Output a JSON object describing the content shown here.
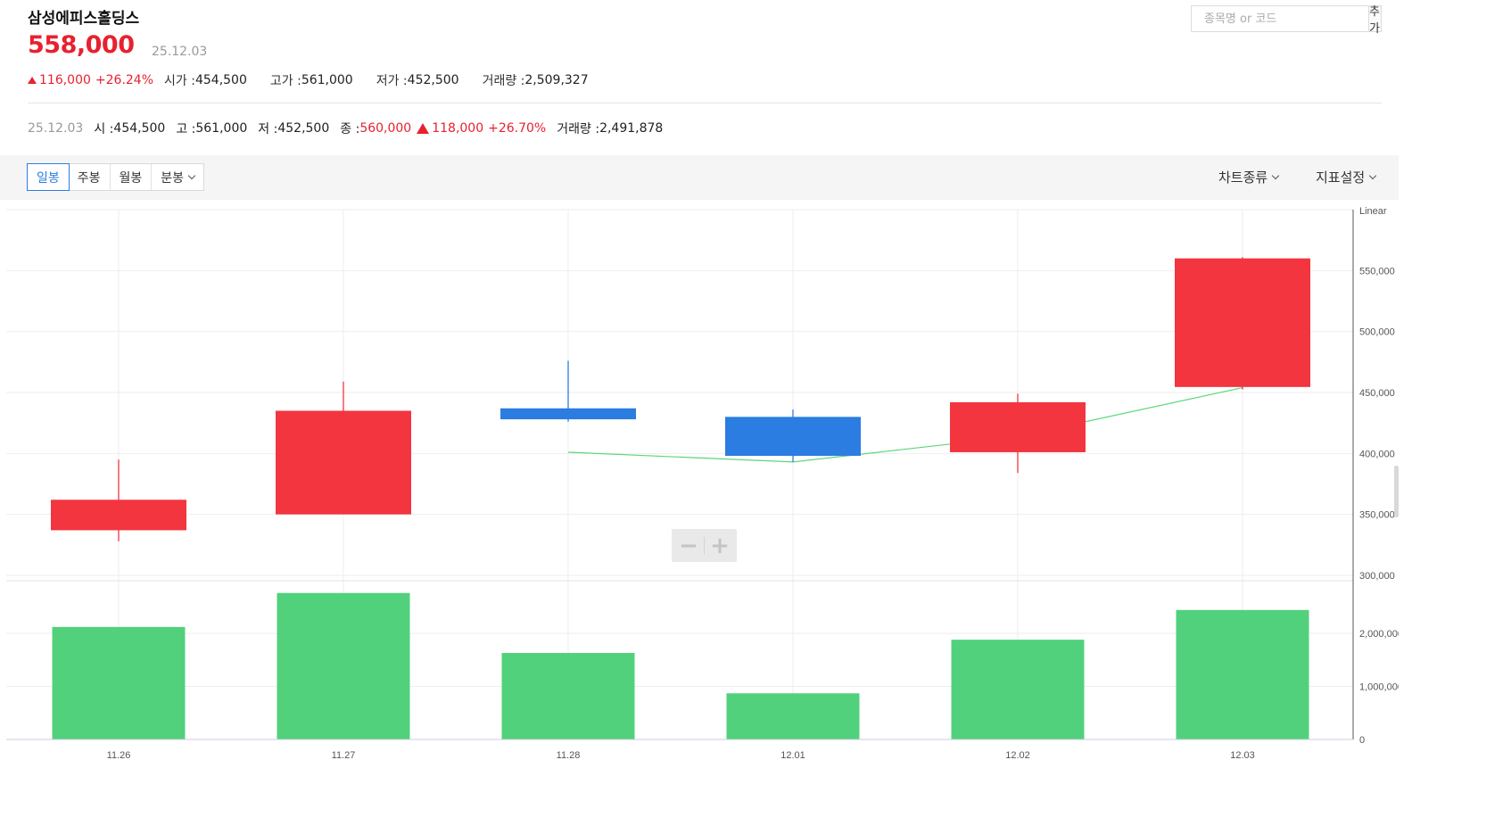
{
  "stock": {
    "name": "삼성에피스홀딩스",
    "price": "558,000",
    "date": "25.12.03",
    "change": "116,000",
    "change_pct": "+26.24%",
    "open_label": "시가 : ",
    "open": "454,500",
    "high_label": "고가 : ",
    "high": "561,000",
    "low_label": "저가 : ",
    "low": "452,500",
    "volume_label": "거래량 : ",
    "volume": "2,509,327"
  },
  "daily": {
    "date": "25.12.03",
    "open_label": "시 : ",
    "open": "454,500",
    "high_label": "고 : ",
    "high": "561,000",
    "low_label": "저 : ",
    "low": "452,500",
    "close_label": "종 : ",
    "close": "560,000",
    "change": "118,000",
    "change_pct": "+26.70%",
    "volume_label": "거래량 : ",
    "volume": "2,491,878"
  },
  "search": {
    "placeholder": "종목명 or 코드",
    "value": "",
    "add_label": "추가"
  },
  "toolbar": {
    "tabs": [
      {
        "label": "일봉",
        "active": true
      },
      {
        "label": "주봉",
        "active": false
      },
      {
        "label": "월봉",
        "active": false
      },
      {
        "label": "분봉",
        "active": false
      }
    ],
    "chart_type_label": "차트종류",
    "indicator_label": "지표설정"
  },
  "zoom": {
    "minus": "−",
    "plus": "+"
  },
  "colors": {
    "up": "#f2353f",
    "down": "#2b7de1",
    "ma": "#5cd67a",
    "volume": "#52d17d",
    "price_text_up": "#e8212f",
    "grid": "#eeeeee"
  },
  "chart_data": {
    "type": "candlestick",
    "scale_label": "Linear",
    "x": [
      "11.26",
      "11.27",
      "11.28",
      "12.01",
      "12.02",
      "12.03"
    ],
    "candles": [
      {
        "date": "11.26",
        "open": 337000,
        "high": 395000,
        "low": 328000,
        "close": 362000
      },
      {
        "date": "11.27",
        "open": 350000,
        "high": 459000,
        "low": 350000,
        "close": 435000
      },
      {
        "date": "11.28",
        "open": 437000,
        "high": 476000,
        "low": 426000,
        "close": 428000
      },
      {
        "date": "12.01",
        "open": 430000,
        "high": 436000,
        "low": 393000,
        "close": 398000
      },
      {
        "date": "12.02",
        "open": 401000,
        "high": 449000,
        "low": 384000,
        "close": 442000
      },
      {
        "date": "12.03",
        "open": 454500,
        "high": 561000,
        "low": 452500,
        "close": 560000
      }
    ],
    "moving_average": {
      "start_index": 2,
      "values": [
        401000,
        393000,
        414000,
        454000
      ]
    },
    "volume": [
      2120000,
      2760000,
      1630000,
      870000,
      1880000,
      2440000
    ],
    "price_axis": {
      "min": 300000,
      "max": 550000,
      "ticks": [
        "550,000",
        "500,000",
        "450,000",
        "400,000",
        "350,000",
        "300,000"
      ]
    },
    "volume_axis": {
      "min": 0,
      "max": 2000000,
      "ticks": [
        "2,000,000",
        "1,000,000",
        "0"
      ]
    },
    "grid": true
  }
}
